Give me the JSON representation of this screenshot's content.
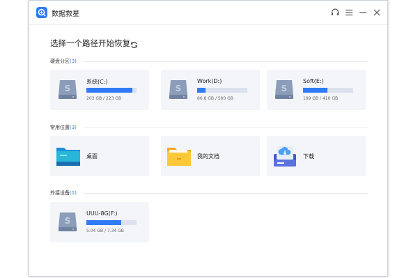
{
  "app": {
    "title": "数据救星"
  },
  "page": {
    "title": "选择一个路径开始恢复"
  },
  "sections": {
    "disks": {
      "label": "硬盘分区",
      "count": "(3)",
      "items": [
        {
          "name": "系统(C:)",
          "size": "203 GB / 223 GB",
          "used_percent": 91
        },
        {
          "name": "Work(D:)",
          "size": "86.8 GB / 500 GB",
          "used_percent": 17
        },
        {
          "name": "Soft(E:)",
          "size": "199 GB / 410 GB",
          "used_percent": 49
        }
      ]
    },
    "common": {
      "label": "常用位置",
      "count": "(3)",
      "items": [
        {
          "name": "桌面"
        },
        {
          "name": "我的文档"
        },
        {
          "name": "下载"
        }
      ]
    },
    "external": {
      "label": "外接设备",
      "count": "(1)",
      "items": [
        {
          "name": "UUU-8G(F:)",
          "size": "5.04 GB / 7.34 GB",
          "used_percent": 69
        }
      ]
    }
  },
  "colors": {
    "accent": "#2f7bf6",
    "card_bg": "#f3f5f9",
    "disk_icon": "#8b9db8"
  }
}
